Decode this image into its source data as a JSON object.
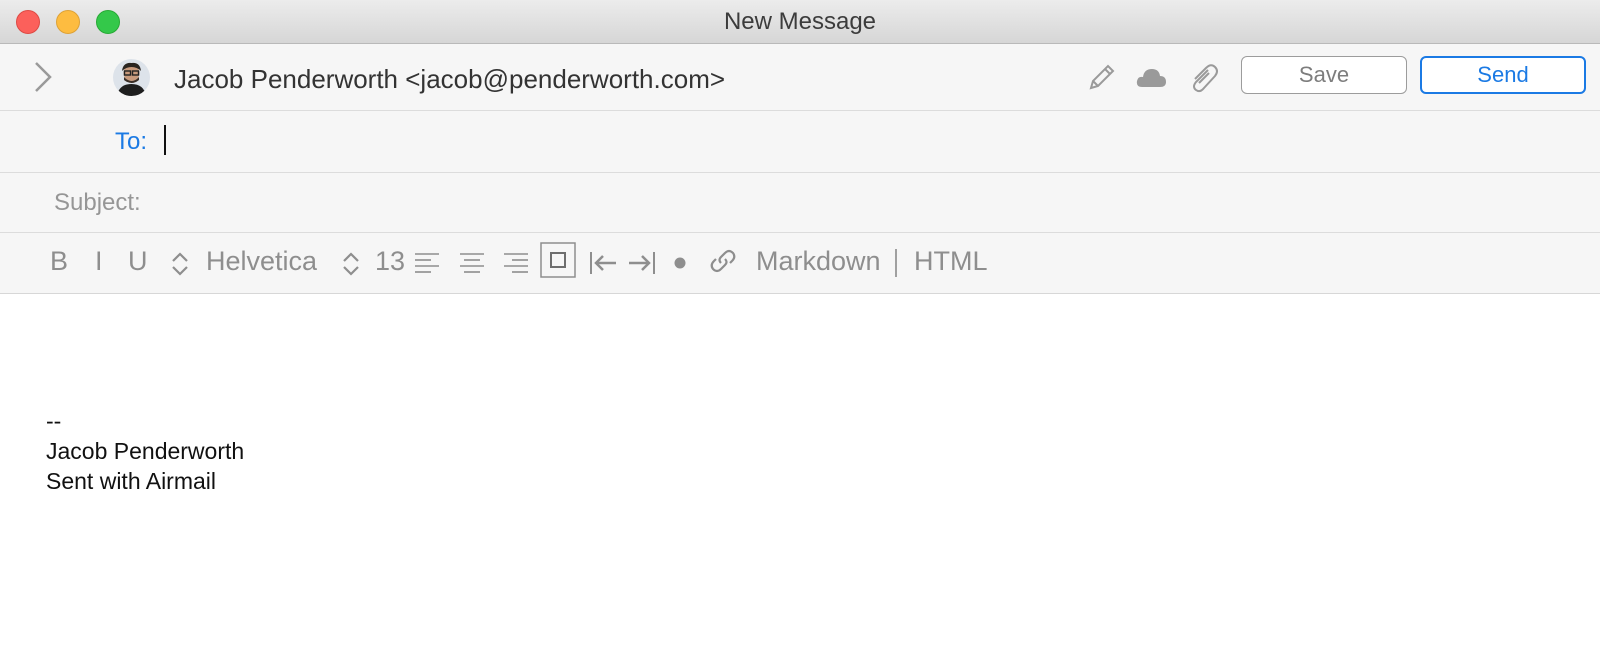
{
  "window": {
    "title": "New Message"
  },
  "header": {
    "from": "Jacob Penderworth <jacob@penderworth.com>",
    "save_label": "Save",
    "send_label": "Send"
  },
  "to": {
    "label": "To:",
    "value": ""
  },
  "subject": {
    "label": "Subject:",
    "value": ""
  },
  "format": {
    "bold": "B",
    "italic": "I",
    "underline": "U",
    "font_name": "Helvetica",
    "font_size": "13",
    "markdown_label": "Markdown",
    "html_label": "HTML"
  },
  "body": {
    "lines": [
      "--",
      "Jacob Penderworth",
      "Sent with Airmail"
    ]
  },
  "colors": {
    "accent": "#1b7ae4",
    "toolbar_bg": "#f6f6f6",
    "icon": "#9a9a9a"
  },
  "icons": [
    "chevron-right-icon",
    "avatar",
    "pencil-icon",
    "cloud-icon",
    "paperclip-icon",
    "stepper-icon",
    "align-left-icon",
    "align-center-icon",
    "align-right-icon",
    "block-icon",
    "outdent-icon",
    "indent-icon",
    "bullet-icon",
    "link-icon"
  ]
}
